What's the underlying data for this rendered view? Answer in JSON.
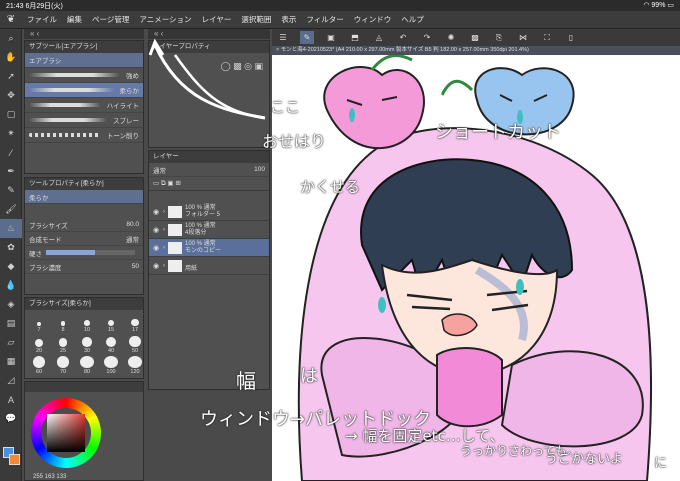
{
  "status": {
    "time": "21:43",
    "date": "6月29日(火)",
    "battery": "99%"
  },
  "menu": [
    "ファイル",
    "編集",
    "ページ管理",
    "アニメーション",
    "レイヤー",
    "選択範囲",
    "表示",
    "フィルター",
    "ウィンドウ",
    "ヘルプ"
  ],
  "subtool": {
    "title": "サブツール[エアブラシ]",
    "header": "エアブラシ",
    "items": [
      {
        "label": "強め",
        "selected": false
      },
      {
        "label": "柔らか",
        "selected": true
      },
      {
        "label": "ハイライト",
        "selected": false
      },
      {
        "label": "スプレー",
        "selected": false
      },
      {
        "label": "トーン削り",
        "selected": false
      }
    ]
  },
  "layer_property": {
    "title": "レイヤープロパティ"
  },
  "tool_property": {
    "title": "ツールプロパティ[柔らか]",
    "name": "柔らか",
    "brush_size_label": "ブラシサイズ",
    "brush_size": "80.0",
    "blend_label": "合成モード",
    "blend_value": "通常",
    "hardness_label": "硬さ",
    "density_label": "ブラシ濃度",
    "density": "50"
  },
  "brush_size_palette": {
    "title": "ブラシサイズ[柔らか]",
    "sizes": [
      "7",
      "8",
      "10",
      "15",
      "17",
      "20",
      "25",
      "30",
      "40",
      "50",
      "60",
      "70",
      "80",
      "100",
      "120"
    ]
  },
  "color": {
    "readout": "255  163  133",
    "main": "#4a90e2",
    "sub": "#f08a3a"
  },
  "layers": {
    "title": "レイヤー",
    "blend": "通常",
    "opacity": "100",
    "rows": [
      {
        "line1": "100 % 通常",
        "line2": "フォルダー 5",
        "selected": false
      },
      {
        "line1": "100 % 通常",
        "line2": "4段落分",
        "selected": false
      },
      {
        "line1": "100 % 通常",
        "line2": "モンのコピー",
        "selected": true
      },
      {
        "line1": "",
        "line2": "用紙",
        "selected": false
      }
    ]
  },
  "canvas": {
    "tab_title": "× モンと海4-20210523* (A4 210.00 x 297.00mm 製本サイズ B5 判 182.00 x 257.00mm 350dpi 201.4%)"
  },
  "annotations": {
    "koko": "ここ",
    "osewa": "おせはり",
    "kakuseru": "かくせる",
    "shortcut": "ショートカット",
    "haba": "幅",
    "ha": "は",
    "window_palette_dock": "ウィンドウ→パレットドック",
    "fix_width": "→ 幅を固定etc…して、",
    "accident": "うっかりさわっても",
    "no_move": "うごかないよ",
    "ni": "に"
  }
}
